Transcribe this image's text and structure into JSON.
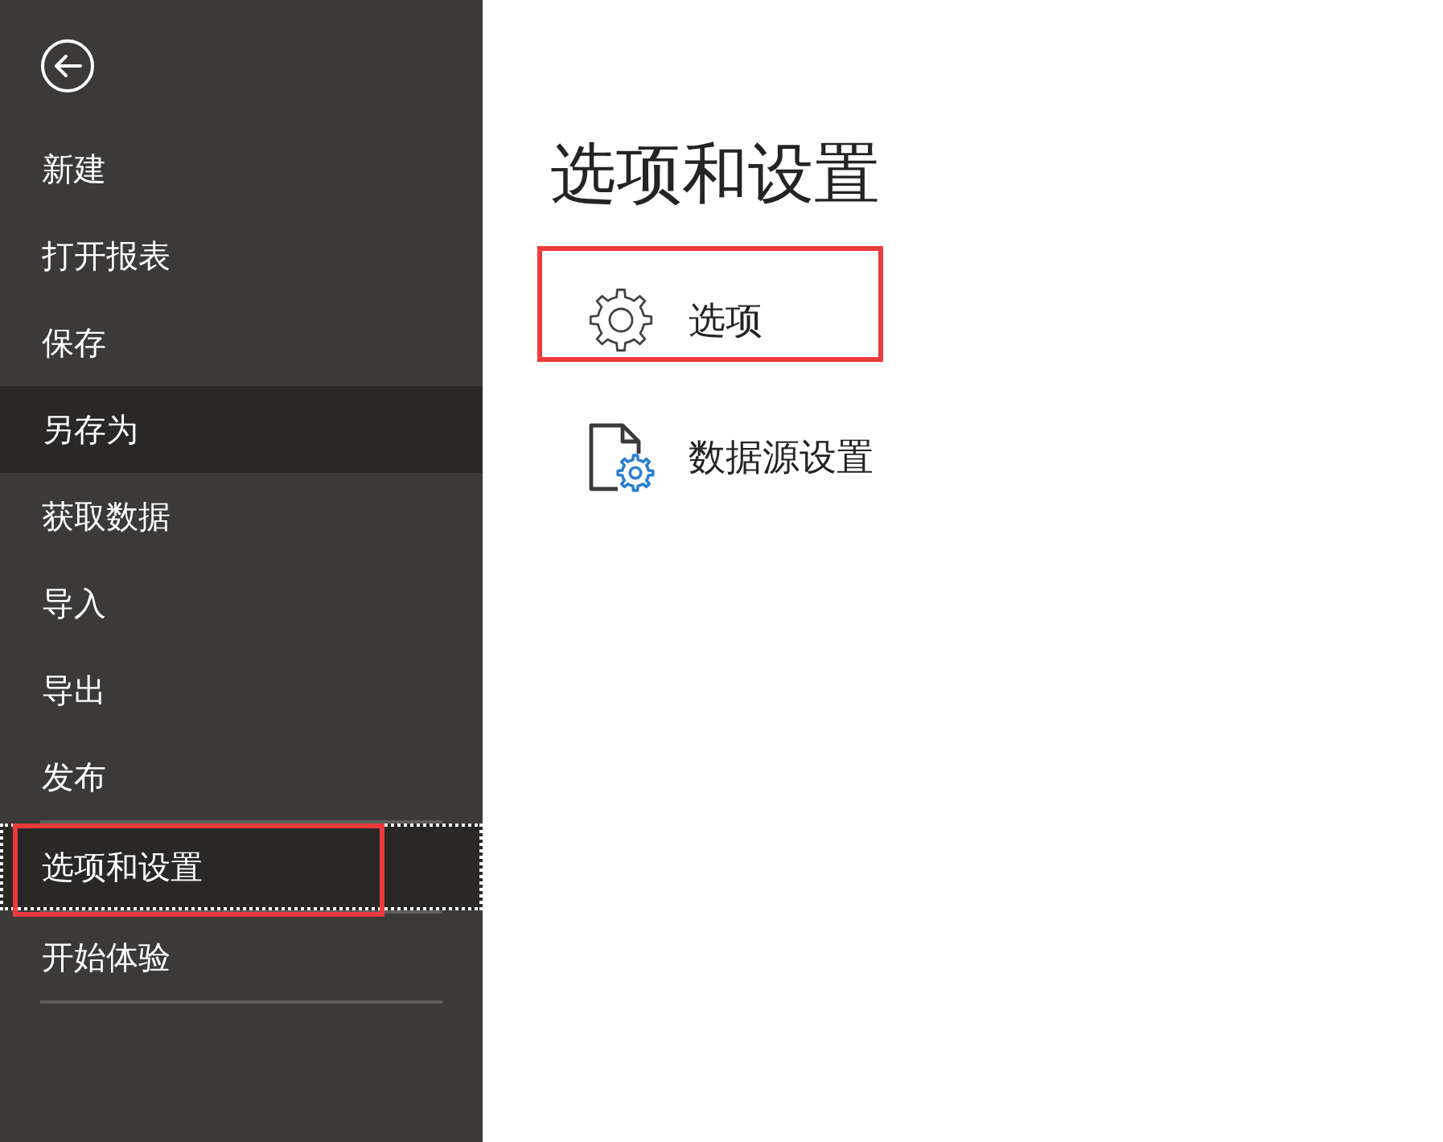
{
  "sidebar": {
    "groups": [
      {
        "items": [
          {
            "label": "新建",
            "selected": false,
            "hovered": false,
            "annotated": false
          },
          {
            "label": "打开报表",
            "selected": false,
            "hovered": false,
            "annotated": false
          },
          {
            "label": "保存",
            "selected": false,
            "hovered": false,
            "annotated": false
          },
          {
            "label": "另存为",
            "selected": false,
            "hovered": true,
            "annotated": false
          },
          {
            "label": "获取数据",
            "selected": false,
            "hovered": false,
            "annotated": false
          },
          {
            "label": "导入",
            "selected": false,
            "hovered": false,
            "annotated": false
          },
          {
            "label": "导出",
            "selected": false,
            "hovered": false,
            "annotated": false
          },
          {
            "label": "发布",
            "selected": false,
            "hovered": false,
            "annotated": false
          }
        ]
      },
      {
        "items": [
          {
            "label": "选项和设置",
            "selected": true,
            "hovered": false,
            "annotated": true
          }
        ]
      },
      {
        "items": [
          {
            "label": "开始体验",
            "selected": false,
            "hovered": false,
            "annotated": false
          }
        ]
      }
    ]
  },
  "page": {
    "title": "选项和设置",
    "options": [
      {
        "label": "选项",
        "kind": "options",
        "annotated": true
      },
      {
        "label": "数据源设置",
        "kind": "datasource",
        "annotated": false
      }
    ]
  }
}
